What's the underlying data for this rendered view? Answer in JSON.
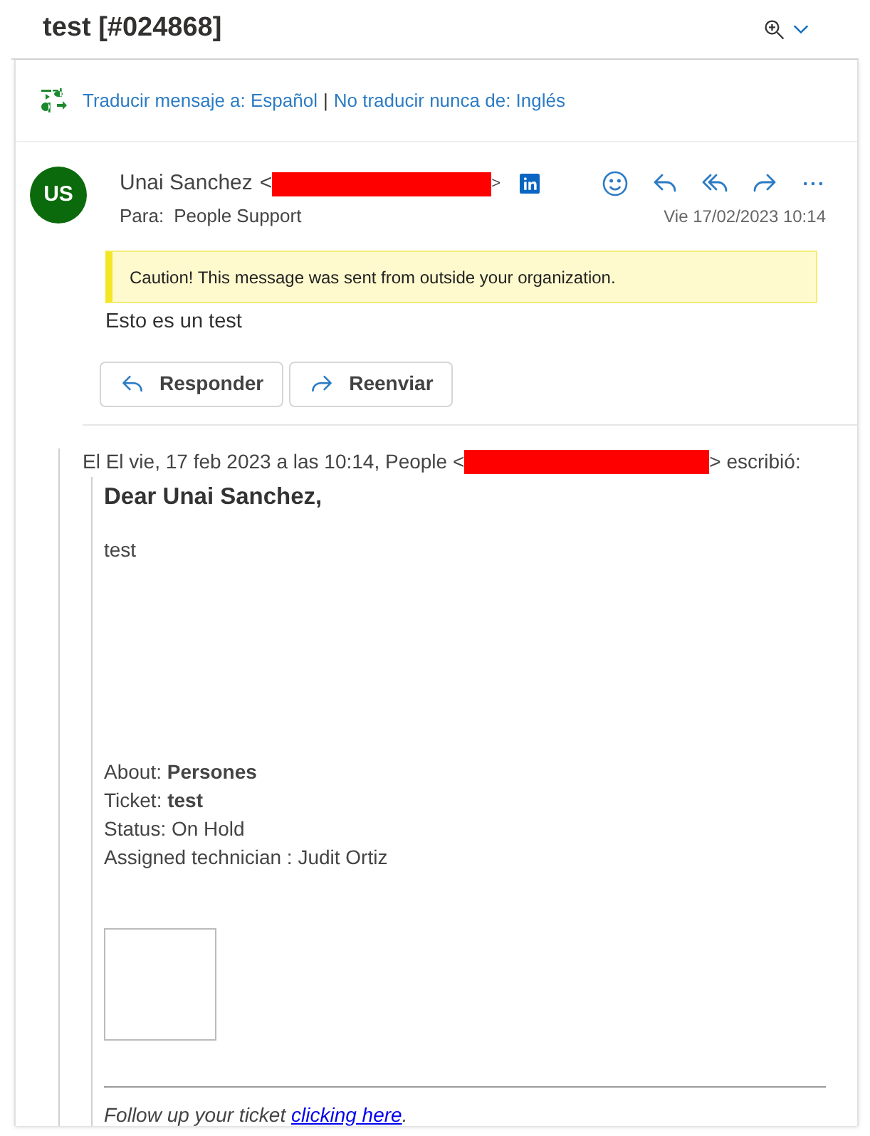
{
  "header": {
    "title": "test [#024868]"
  },
  "translation": {
    "translate_link": "Traducir mensaje a: Español",
    "separator": "|",
    "never_link": "No traducir nunca de: Inglés"
  },
  "message": {
    "avatar_initials": "US",
    "sender_name": "Unai Sanchez",
    "sender_open": "<",
    "sender_close": ">",
    "to_label": "Para:",
    "to": "People Support",
    "date": "Vie 17/02/2023 10:14",
    "caution": "Caution! This message was sent from outside your organization.",
    "body": "Esto es un test",
    "buttons": [
      {
        "label": "Responder",
        "kind": "reply"
      },
      {
        "label": "Reenviar",
        "kind": "forward"
      }
    ]
  },
  "quoted": {
    "intro_start": "El El vie, 17 feb 2023 a las 10:14, People <",
    "intro_end": "> escribió:",
    "greeting": "Dear Unai Sanchez,",
    "text": "test",
    "fields": [
      "About: **Persones**",
      "Ticket: **test**",
      "Status: On Hold",
      "Assigned technician : Judit Ortiz"
    ],
    "footer": "Follow up your ticket",
    "link": "clicking here",
    "footer_end": "."
  }
}
